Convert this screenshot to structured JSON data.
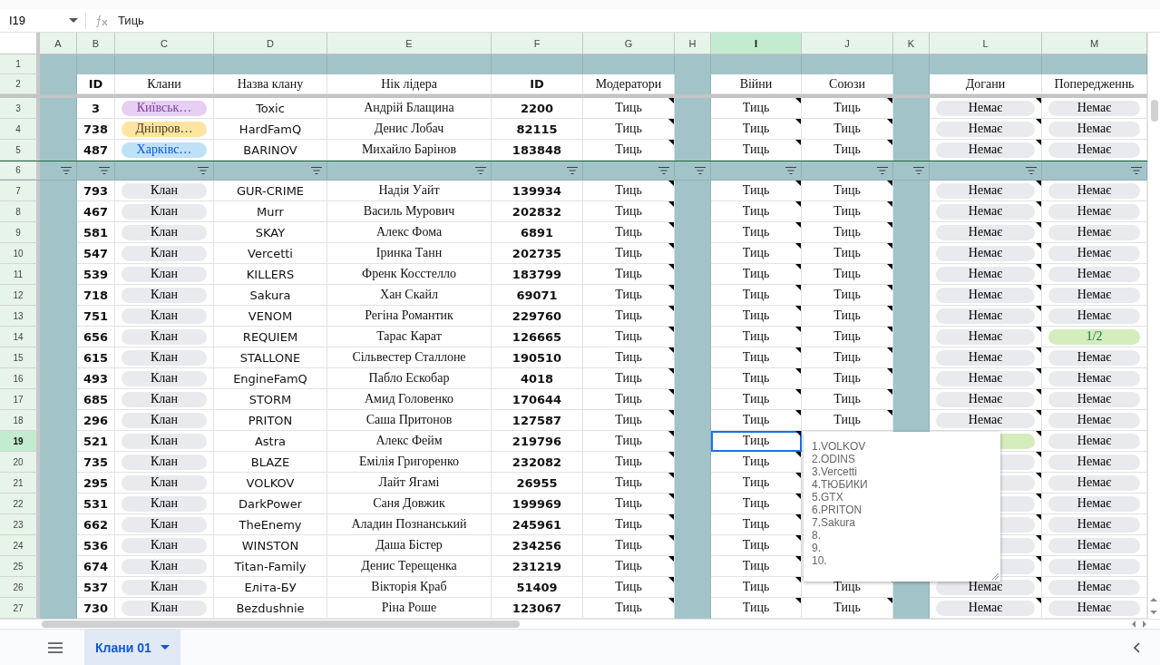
{
  "name_box": {
    "value": "I19"
  },
  "formula_bar": {
    "value": "Тиць"
  },
  "columns": [
    {
      "label": "A",
      "selected": false
    },
    {
      "label": "B",
      "selected": false
    },
    {
      "label": "C",
      "selected": false
    },
    {
      "label": "D",
      "selected": false
    },
    {
      "label": "E",
      "selected": false
    },
    {
      "label": "F",
      "selected": false
    },
    {
      "label": "G",
      "selected": false
    },
    {
      "label": "H",
      "selected": false
    },
    {
      "label": "I",
      "selected": true
    },
    {
      "label": "J",
      "selected": false
    },
    {
      "label": "K",
      "selected": false
    },
    {
      "label": "L",
      "selected": false
    },
    {
      "label": "M",
      "selected": false
    }
  ],
  "top_rows": [
    {
      "number": "1",
      "selected": false
    },
    {
      "number": "2",
      "selected": false
    }
  ],
  "headers": {
    "id": "ID",
    "clan": "Клани",
    "name": "Назва клану",
    "leader": "Нік лідера",
    "player_id": "ID",
    "moderators": "Модератори",
    "wars": "Війни",
    "alliances": "Союзи",
    "reprimands": "Догани",
    "warnings": "Попередженнь"
  },
  "frozen_rows": [
    {
      "number": "3",
      "selected": false,
      "id": "3",
      "clan": {
        "text": "Київськ…",
        "color": "#e6cff2"
      },
      "name": "Toxic",
      "leader": "Андрій Блащина",
      "player_id": "2200",
      "moderators": "Тиць",
      "wars": "Тиць",
      "alliances": "Тиць",
      "reprimands": {
        "text": "Немає",
        "color": "#e8eaed"
      },
      "warnings": {
        "text": "Немає",
        "color": "#e8eaed"
      }
    },
    {
      "number": "4",
      "selected": false,
      "id": "738",
      "clan": {
        "text": "Дніпров…",
        "color": "#ffe5a0"
      },
      "name": "HardFamQ",
      "leader": "Денис Лобач",
      "player_id": "82115",
      "moderators": "Тиць",
      "wars": "Тиць",
      "alliances": "Тиць",
      "reprimands": {
        "text": "Немає",
        "color": "#e8eaed"
      },
      "warnings": {
        "text": "Немає",
        "color": "#e8eaed"
      }
    },
    {
      "number": "5",
      "selected": false,
      "id": "487",
      "clan": {
        "text": "Харківс…",
        "color": "#bfe1f6"
      },
      "name": "BARINOV",
      "leader": "Михайло Барінов",
      "player_id": "183848",
      "moderators": "Тиць",
      "wars": "Тиць",
      "alliances": "Тиць",
      "reprimands": {
        "text": "Немає",
        "color": "#e8eaed"
      },
      "warnings": {
        "text": "Немає",
        "color": "#e8eaed"
      }
    }
  ],
  "filter_row": {
    "number": "6",
    "selected": false
  },
  "rows": [
    {
      "number": "7",
      "selected": false,
      "id": "793",
      "clan": {
        "text": "Клан",
        "color": "#e8eaed"
      },
      "name": "GUR-CRIME",
      "leader": "Надія Уайт",
      "player_id": "139934",
      "moderators": "Тиць",
      "wars": "Тиць",
      "alliances": "Тиць",
      "reprimands": {
        "text": "Немає",
        "color": "#e8eaed"
      },
      "warnings": {
        "text": "Немає",
        "color": "#e8eaed"
      }
    },
    {
      "number": "8",
      "selected": false,
      "id": "467",
      "clan": {
        "text": "Клан",
        "color": "#e8eaed"
      },
      "name": "Murr",
      "leader": "Василь Мурович",
      "player_id": "202832",
      "moderators": "Тиць",
      "wars": "Тиць",
      "alliances": "Тиць",
      "reprimands": {
        "text": "Немає",
        "color": "#e8eaed"
      },
      "warnings": {
        "text": "Немає",
        "color": "#e8eaed"
      }
    },
    {
      "number": "9",
      "selected": false,
      "id": "581",
      "clan": {
        "text": "Клан",
        "color": "#e8eaed"
      },
      "name": "SKAY",
      "leader": "Алекс Фома",
      "player_id": "6891",
      "moderators": "Тиць",
      "wars": "Тиць",
      "alliances": "Тиць",
      "reprimands": {
        "text": "Немає",
        "color": "#e8eaed"
      },
      "warnings": {
        "text": "Немає",
        "color": "#e8eaed"
      }
    },
    {
      "number": "10",
      "selected": false,
      "id": "547",
      "clan": {
        "text": "Клан",
        "color": "#e8eaed"
      },
      "name": "Vercetti",
      "leader": "Іринка Танн",
      "player_id": "202735",
      "moderators": "Тиць",
      "wars": "Тиць",
      "alliances": "Тиць",
      "reprimands": {
        "text": "Немає",
        "color": "#e8eaed"
      },
      "warnings": {
        "text": "Немає",
        "color": "#e8eaed"
      }
    },
    {
      "number": "11",
      "selected": false,
      "id": "539",
      "clan": {
        "text": "Клан",
        "color": "#e8eaed"
      },
      "name": "KILLERS",
      "leader": "Френк Косстелло",
      "player_id": "183799",
      "moderators": "Тиць",
      "wars": "Тиць",
      "alliances": "Тиць",
      "reprimands": {
        "text": "Немає",
        "color": "#e8eaed"
      },
      "warnings": {
        "text": "Немає",
        "color": "#e8eaed"
      }
    },
    {
      "number": "12",
      "selected": false,
      "id": "718",
      "clan": {
        "text": "Клан",
        "color": "#e8eaed"
      },
      "name": "Sakura",
      "leader": "Хан Скайл",
      "player_id": "69071",
      "moderators": "Тиць",
      "wars": "Тиць",
      "alliances": "Тиць",
      "reprimands": {
        "text": "Немає",
        "color": "#e8eaed"
      },
      "warnings": {
        "text": "Немає",
        "color": "#e8eaed"
      }
    },
    {
      "number": "13",
      "selected": false,
      "id": "751",
      "clan": {
        "text": "Клан",
        "color": "#e8eaed"
      },
      "name": "VENOM",
      "leader": "Регіна Романтик",
      "player_id": "229760",
      "moderators": "Тиць",
      "wars": "Тиць",
      "alliances": "Тиць",
      "reprimands": {
        "text": "Немає",
        "color": "#e8eaed"
      },
      "warnings": {
        "text": "Немає",
        "color": "#e8eaed"
      }
    },
    {
      "number": "14",
      "selected": false,
      "id": "656",
      "clan": {
        "text": "Клан",
        "color": "#e8eaed"
      },
      "name": "REQUIEM",
      "leader": "Тарас Карат",
      "player_id": "126665",
      "moderators": "Тиць",
      "wars": "Тиць",
      "alliances": "Тиць",
      "reprimands": {
        "text": "Немає",
        "color": "#e8eaed"
      },
      "warnings": {
        "text": "1/2",
        "color": "#d4edbc"
      }
    },
    {
      "number": "15",
      "selected": false,
      "id": "615",
      "clan": {
        "text": "Клан",
        "color": "#e8eaed"
      },
      "name": "STALLONE",
      "leader": "Сільвестер Сталлоне",
      "player_id": "190510",
      "moderators": "Тиць",
      "wars": "Тиць",
      "alliances": "Тиць",
      "reprimands": {
        "text": "Немає",
        "color": "#e8eaed"
      },
      "warnings": {
        "text": "Немає",
        "color": "#e8eaed"
      }
    },
    {
      "number": "16",
      "selected": false,
      "id": "493",
      "clan": {
        "text": "Клан",
        "color": "#e8eaed"
      },
      "name": "EngineFamQ",
      "leader": "Пабло Ескобар",
      "player_id": "4018",
      "moderators": "Тиць",
      "wars": "Тиць",
      "alliances": "Тиць",
      "reprimands": {
        "text": "Немає",
        "color": "#e8eaed"
      },
      "warnings": {
        "text": "Немає",
        "color": "#e8eaed"
      }
    },
    {
      "number": "17",
      "selected": false,
      "id": "685",
      "clan": {
        "text": "Клан",
        "color": "#e8eaed"
      },
      "name": "STORM",
      "leader": "Амид Головенко",
      "player_id": "170644",
      "moderators": "Тиць",
      "wars": "Тиць",
      "alliances": "Тиць",
      "reprimands": {
        "text": "Немає",
        "color": "#e8eaed"
      },
      "warnings": {
        "text": "Немає",
        "color": "#e8eaed"
      }
    },
    {
      "number": "18",
      "selected": false,
      "id": "296",
      "clan": {
        "text": "Клан",
        "color": "#e8eaed"
      },
      "name": "PRITON",
      "leader": "Саша Притонов",
      "player_id": "127587",
      "moderators": "Тиць",
      "wars": "Тиць",
      "alliances": "Тиць",
      "reprimands": {
        "text": "Немає",
        "color": "#e8eaed"
      },
      "warnings": {
        "text": "Немає",
        "color": "#e8eaed"
      }
    },
    {
      "number": "19",
      "selected": true,
      "id": "521",
      "clan": {
        "text": "Клан",
        "color": "#e8eaed"
      },
      "name": "Astra",
      "leader": "Алекс Фейм",
      "player_id": "219796",
      "moderators": "Тиць",
      "wars": "Тиць",
      "reprimands": {
        "color": "#d4edbc"
      },
      "warnings": {
        "text": "Немає",
        "color": "#e8eaed"
      }
    },
    {
      "number": "20",
      "selected": false,
      "id": "735",
      "clan": {
        "text": "Клан",
        "color": "#e8eaed"
      },
      "name": "BLAZE",
      "leader": "Емілія Григоренко",
      "player_id": "232082",
      "moderators": "Тиць",
      "wars": "Тиць",
      "reprimands": {
        "color": "#e8eaed"
      },
      "warnings": {
        "text": "Немає",
        "color": "#e8eaed"
      }
    },
    {
      "number": "21",
      "selected": false,
      "id": "295",
      "clan": {
        "text": "Клан",
        "color": "#e8eaed"
      },
      "name": "VOLKOV",
      "leader": "Лайт Ягамі",
      "player_id": "26955",
      "moderators": "Тиць",
      "wars": "Тиць",
      "reprimands": {
        "color": "#e8eaed"
      },
      "warnings": {
        "text": "Немає",
        "color": "#e8eaed"
      }
    },
    {
      "number": "22",
      "selected": false,
      "id": "531",
      "clan": {
        "text": "Клан",
        "color": "#e8eaed"
      },
      "name": "DarkPower",
      "leader": "Саня Довжик",
      "player_id": "199969",
      "moderators": "Тиць",
      "wars": "Тиць",
      "reprimands": {
        "color": "#e8eaed"
      },
      "warnings": {
        "text": "Немає",
        "color": "#e8eaed"
      }
    },
    {
      "number": "23",
      "selected": false,
      "id": "662",
      "clan": {
        "text": "Клан",
        "color": "#e8eaed"
      },
      "name": "TheEnemy",
      "leader": "Аладин Познанський",
      "player_id": "245961",
      "moderators": "Тиць",
      "wars": "Тиць",
      "reprimands": {
        "color": "#e8eaed"
      },
      "warnings": {
        "text": "Немає",
        "color": "#e8eaed"
      }
    },
    {
      "number": "24",
      "selected": false,
      "id": "536",
      "clan": {
        "text": "Клан",
        "color": "#e8eaed"
      },
      "name": "WINSTON",
      "leader": "Даша Бістер",
      "player_id": "234256",
      "moderators": "Тиць",
      "wars": "Тиць",
      "reprimands": {
        "color": "#e8eaed"
      },
      "warnings": {
        "text": "Немає",
        "color": "#e8eaed"
      }
    },
    {
      "number": "25",
      "selected": false,
      "id": "674",
      "clan": {
        "text": "Клан",
        "color": "#e8eaed"
      },
      "name": "Titan-Family",
      "leader": "Денис Терещенка",
      "player_id": "231219",
      "moderators": "Тиць",
      "wars": "Тиць",
      "reprimands": {
        "color": "#e8eaed"
      },
      "warnings": {
        "text": "Немає",
        "color": "#e8eaed"
      }
    },
    {
      "number": "26",
      "selected": false,
      "id": "537",
      "clan": {
        "text": "Клан",
        "color": "#e8eaed"
      },
      "name": "Еліта-БУ",
      "leader": "Вікторія Краб",
      "player_id": "51409",
      "moderators": "Тиць",
      "wars": "Тиць",
      "alliances": "Тиць",
      "reprimands": {
        "text": "Немає",
        "color": "#e8eaed"
      },
      "warnings": {
        "text": "Немає",
        "color": "#e8eaed"
      }
    },
    {
      "number": "27",
      "selected": false,
      "id": "730",
      "clan": {
        "text": "Клан",
        "color": "#e8eaed"
      },
      "name": "Bezdushnie",
      "leader": "Ріна Роше",
      "player_id": "123067",
      "moderators": "Тиць",
      "wars": "Тиць",
      "alliances": "Тиць",
      "reprimands": {
        "text": "Немає",
        "color": "#e8eaed"
      },
      "warnings": {
        "text": "Немає",
        "color": "#e8eaed"
      }
    }
  ],
  "note": {
    "lines": [
      "1.VOLKOV",
      "2.ODINS",
      "3.Vercetti",
      "4.ТЮБИКИ",
      "5.GTX",
      "6.PRITON",
      "7.Sakura",
      "8.",
      "9.",
      "10."
    ]
  },
  "sheet_tabs": [
    {
      "label": "Клани 01",
      "selected": true
    }
  ]
}
